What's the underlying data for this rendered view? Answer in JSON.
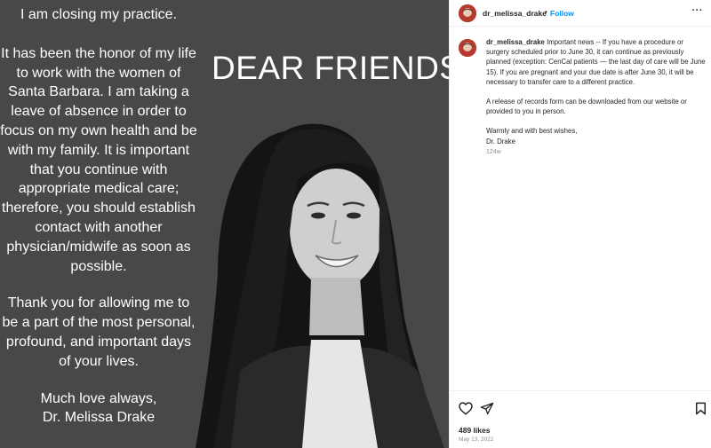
{
  "post": {
    "letter": {
      "opening": "I am closing my practice.",
      "para1": "It has been the honor of my life to work with the women of Santa Barbara. I am taking a leave of absence in order to focus on my own health and be with my family. It is important that you continue with appropriate medical care; therefore, you should establish contact with another physician/midwife as soon as possible.",
      "para2": "Thank you for allowing me to be a part of the most personal, profound, and important days of your lives.",
      "closing1": "Much love always,",
      "closing2": "Dr. Melissa Drake"
    },
    "headline": "DEAR FRIENDS,"
  },
  "header": {
    "username": "dr_melissa_drake",
    "dot": "•",
    "follow": "Follow",
    "more": "···"
  },
  "caption": {
    "username": "dr_melissa_drake",
    "text1": "Important news -- If you have a procedure or surgery scheduled prior to June 30, it can continue as previously planned (exception: CenCal patients — the last day of care will be June 15). If you are pregnant and your due date is after June 30, it will be necessary to transfer care to a different practice.",
    "text2": "A release of records form can be downloaded from our website or provided to you in person.",
    "text3": "Warmly and with best wishes,",
    "text4": "Dr. Drake",
    "time_ago": "124w"
  },
  "footer": {
    "likes": "489 likes",
    "date": "May 13, 2022"
  },
  "icons": {
    "heart": "heart-icon",
    "share": "share-icon",
    "bookmark": "bookmark-icon",
    "avatar": "avatar"
  },
  "colors": {
    "image_background": "#4a4749",
    "follow": "#0095f6",
    "muted_text": "#8e8e8e",
    "avatar_accent": "#b73a2e"
  }
}
